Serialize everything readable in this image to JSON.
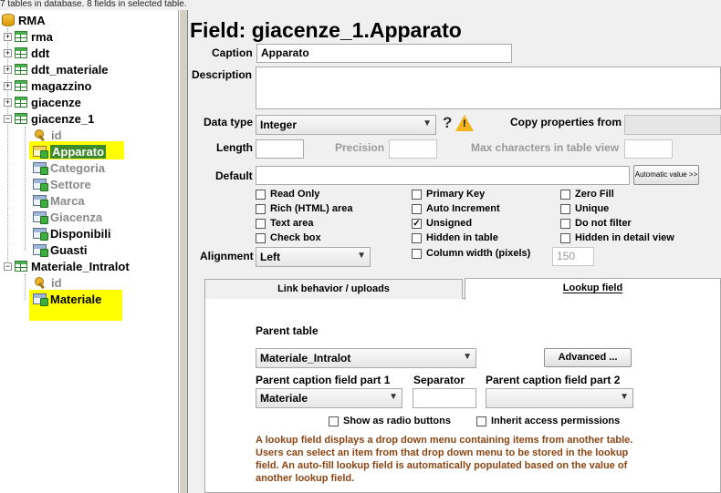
{
  "status": "7 tables in database. 8 fields in selected table.",
  "tree": {
    "root": "RMA",
    "tables": [
      "rma",
      "ddt",
      "ddt_materiale",
      "magazzino",
      "giacenze",
      "giacenze_1"
    ],
    "giacenze_fields": [
      "id",
      "Apparato",
      "Categoria",
      "Settore",
      "Marca",
      "Giacenza",
      "Disponibili",
      "Guasti"
    ],
    "table2": "Materiale_Intralot",
    "table2_fields": [
      "id",
      "Materiale"
    ],
    "expander_plus": "+",
    "expander_minus": "−"
  },
  "field": {
    "title": "Field: giacenze_1.Apparato",
    "caption_label": "Caption",
    "caption_value": "Apparato",
    "description_label": "Description",
    "description_value": "",
    "datatype_label": "Data type",
    "datatype_value": "Integer",
    "help_glyph": "?",
    "warning_glyph": "!",
    "copy_label": "Copy properties from",
    "copy_value": "",
    "length_label": "Length",
    "length_value": "",
    "precision_label": "Precision",
    "precision_value": "",
    "maxchars_label": "Max characters in table view",
    "maxchars_value": "",
    "default_label": "Default",
    "default_value": "",
    "auto_value_button": "Automatic value >>",
    "alignment_label": "Alignment",
    "alignment_value": "Left",
    "colwidth_label": "Column width (pixels)",
    "colwidth_value": "150"
  },
  "checkboxes": {
    "col1": [
      {
        "label": "Read Only",
        "checked": false
      },
      {
        "label": "Rich (HTML) area",
        "checked": false
      },
      {
        "label": "Text area",
        "checked": false
      },
      {
        "label": "Check box",
        "checked": false
      }
    ],
    "col2": [
      {
        "label": "Primary Key",
        "checked": false
      },
      {
        "label": "Auto Increment",
        "checked": false
      },
      {
        "label": "Unsigned",
        "checked": true
      },
      {
        "label": "Hidden in table",
        "checked": false
      }
    ],
    "col3": [
      {
        "label": "Zero Fill",
        "checked": false
      },
      {
        "label": "Unique",
        "checked": false
      },
      {
        "label": "Do not filter",
        "checked": false
      },
      {
        "label": "Hidden in detail view",
        "checked": false
      }
    ],
    "checkmark": "✓"
  },
  "tabs": {
    "link": "Link behavior / uploads",
    "lookup": "Lookup field"
  },
  "lookup": {
    "parent_table_label": "Parent table",
    "parent_table_value": "Materiale_Intralot",
    "advanced_button": "Advanced ...",
    "caption1_label": "Parent caption field part 1",
    "caption1_value": "Materiale",
    "separator_label": "Separator",
    "separator_value": "",
    "caption2_label": "Parent caption field part 2",
    "caption2_value": "",
    "radio_label": "Show as radio buttons",
    "inherit_label": "Inherit access permissions",
    "note": "A lookup field displays a drop down menu containing items from another table. Users can select an item from that drop down menu to be stored in the lookup field. An auto-fill lookup field is automatically populated based on the value of another lookup field."
  },
  "colors": {
    "highlight": "#ffff00",
    "note": "#8b4513",
    "table_icon": "#4caf50"
  }
}
